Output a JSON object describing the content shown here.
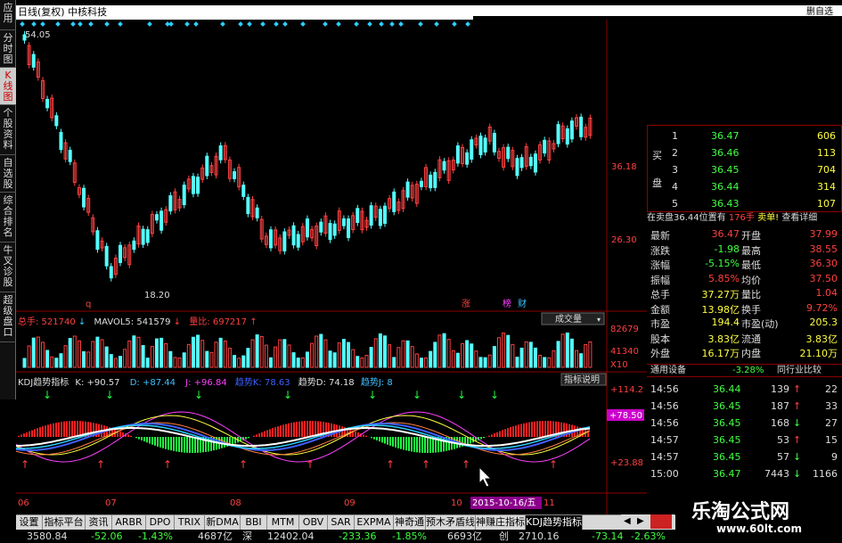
{
  "window": {
    "title": "日线(复权)  中核科技",
    "right_label": "删自选"
  },
  "left_nav": [
    {
      "label": "应用",
      "active": false
    },
    {
      "label": "分时图",
      "active": false
    },
    {
      "label": "K线图",
      "active": true
    },
    {
      "label": "个股资料",
      "active": false
    },
    {
      "label": "自选股",
      "active": false
    },
    {
      "label": "综合排名",
      "active": false
    },
    {
      "label": "牛叉诊股",
      "active": false
    },
    {
      "label": "超级盘口",
      "active": false
    }
  ],
  "price_chart": {
    "high_label": "54.05",
    "low_label": "18.20",
    "grid_labels": [
      "36.18",
      "26.30"
    ],
    "markers": [
      "q",
      "涨",
      "榜",
      "财"
    ]
  },
  "volume_panel": {
    "header": [
      {
        "text": "总手: 521740",
        "color": "#ff4040"
      },
      {
        "text": "MAVOL5: 541579",
        "color": "#e0e0e0"
      },
      {
        "text": "量比: 697217",
        "color": "#ff4040"
      }
    ],
    "dropdown": "成交量",
    "scale_labels": [
      "82679",
      "41340",
      "X10"
    ]
  },
  "kdj_panel": {
    "header": [
      {
        "text": "KDJ趋势指标",
        "color": "#e0e0e0"
      },
      {
        "text": "K: +90.57",
        "color": "#e0e0e0"
      },
      {
        "text": "D: +87.44",
        "color": "#40c0ff"
      },
      {
        "text": "J: +96.84",
        "color": "#ff40ff"
      },
      {
        "text": "趋势K: 78.63",
        "color": "#4060ff"
      },
      {
        "text": "趋势D: 74.18",
        "color": "#e0e0e0"
      },
      {
        "text": "趋势J: 8",
        "color": "#40c0ff"
      }
    ],
    "button": "指标说明",
    "scale_labels": [
      "+114.2",
      "+78.50",
      "+23.88"
    ]
  },
  "x_axis": {
    "labels": [
      "06",
      "07",
      "08",
      "09",
      "10",
      "11"
    ],
    "cursor_date": "2015-10-16/五"
  },
  "order_book": {
    "side_label_buy": "买",
    "side_label_plate": "盘",
    "rows": [
      {
        "level": "1",
        "price": "36.47",
        "vol": "606"
      },
      {
        "level": "2",
        "price": "36.46",
        "vol": "113"
      },
      {
        "level": "3",
        "price": "36.45",
        "vol": "704"
      },
      {
        "level": "4",
        "price": "36.44",
        "vol": "314"
      },
      {
        "level": "5",
        "price": "36.43",
        "vol": "107"
      }
    ],
    "summary": {
      "left": "在卖盘36.44位置有",
      "mid": "176手",
      "tag": "卖单!",
      "link": "查看详细"
    }
  },
  "quote": [
    {
      "l1": "最新",
      "v1": "36.47",
      "l2": "开盘",
      "v2": "37.99"
    },
    {
      "l1": "涨跌",
      "v1": "-1.98",
      "l2": "最高",
      "v2": "38.55"
    },
    {
      "l1": "涨幅",
      "v1": "-5.15%",
      "l2": "最低",
      "v2": "36.30"
    },
    {
      "l1": "振幅",
      "v1": "5.85%",
      "l2": "均价",
      "v2": "37.50"
    },
    {
      "l1": "总手",
      "v1": "37.27万",
      "l2": "量比",
      "v2": "1.04"
    },
    {
      "l1": "金额",
      "v1": "13.98亿",
      "l2": "换手",
      "v2": "9.72%"
    },
    {
      "l1": "市盈",
      "v1": "194.4",
      "l2": "市盈(动)",
      "v2": "205.3"
    },
    {
      "l1": "股本",
      "v1": "3.83亿",
      "l2": "流通",
      "v2": "3.83亿"
    },
    {
      "l1": "外盘",
      "v1": "16.17万",
      "l2": "内盘",
      "v2": "21.10万"
    }
  ],
  "sector": {
    "name": "通用设备",
    "change": "-3.28%",
    "link": "同行业比较"
  },
  "ticks": [
    {
      "time": "14:56",
      "price": "36.44",
      "vol": "139",
      "dir": "up",
      "n": "22"
    },
    {
      "time": "14:56",
      "price": "36.45",
      "vol": "187",
      "dir": "up",
      "n": "33"
    },
    {
      "time": "14:56",
      "price": "36.45",
      "vol": "168",
      "dir": "down",
      "n": "27"
    },
    {
      "time": "14:57",
      "price": "36.45",
      "vol": "53",
      "dir": "up",
      "n": "15"
    },
    {
      "time": "14:57",
      "price": "36.45",
      "vol": "57",
      "dir": "down",
      "n": "9"
    },
    {
      "time": "15:00",
      "price": "36.47",
      "vol": "7443",
      "dir": "down",
      "n": "1166"
    }
  ],
  "bottom_tabs": [
    "设置",
    "指标平台",
    "资讯",
    "ARBR",
    "DPO",
    "TRIX",
    "新DMA",
    "BBI",
    "MTM",
    "OBV",
    "SAR",
    "EXPMA",
    "神奇通",
    "预木矛盾线",
    "神赚庄指标",
    "KDJ趋势指标"
  ],
  "active_tab": "KDJ趋势指标",
  "status": [
    "3580.84",
    "-52.06",
    "-1.43%",
    "4687亿",
    "深",
    "12402.04",
    "-233.36",
    "-1.85%",
    "6693亿",
    "创",
    "2710.16",
    "-73.14",
    "-2.63%"
  ],
  "watermark": {
    "title": "乐淘公式网",
    "url": "www.60lt.com"
  }
}
